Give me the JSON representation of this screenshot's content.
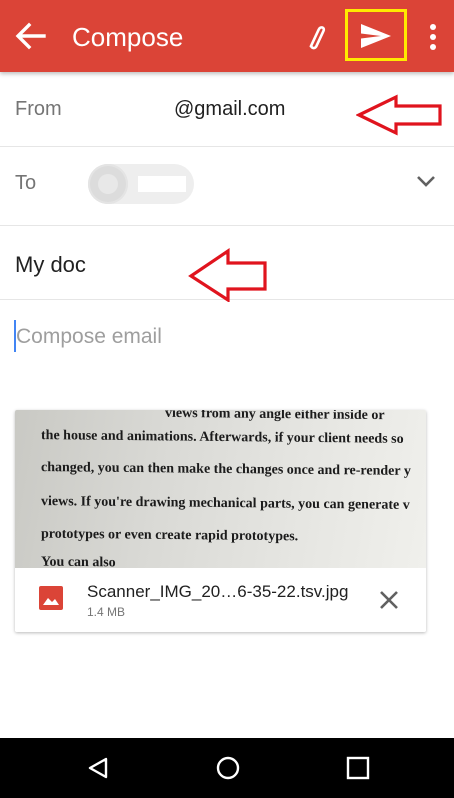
{
  "app_bar": {
    "title": "Compose",
    "back_icon": "arrow-back-icon",
    "attach_icon": "paperclip-icon",
    "send_icon": "send-icon",
    "more_icon": "more-vert-icon",
    "background_color": "#db4437",
    "highlight_color": "#ffeb00"
  },
  "from": {
    "label": "From",
    "value": "@gmail.com"
  },
  "to": {
    "label": "To",
    "expand_icon": "chevron-down-icon"
  },
  "subject": {
    "value": "My doc"
  },
  "body": {
    "placeholder": "Compose email",
    "value": ""
  },
  "attachment": {
    "preview_lines": [
      "views from any angle either inside or",
      "the house and animations. Afterwards, if your client needs so",
      "changed, you can then make the changes once and re-render y",
      "views. If you're drawing mechanical parts, you can generate v",
      "prototypes or even create rapid prototypes.",
      "You can also"
    ],
    "file_name": "Scanner_IMG_20…6-35-22.tsv.jpg",
    "file_size": "1.4 MB",
    "file_icon": "image-file-icon",
    "remove_icon": "close-icon"
  },
  "annotations": {
    "arrow_color": "#e0141e"
  },
  "nav_bar": {
    "back_icon": "nav-back-icon",
    "home_icon": "nav-home-icon",
    "recents_icon": "nav-recents-icon"
  }
}
